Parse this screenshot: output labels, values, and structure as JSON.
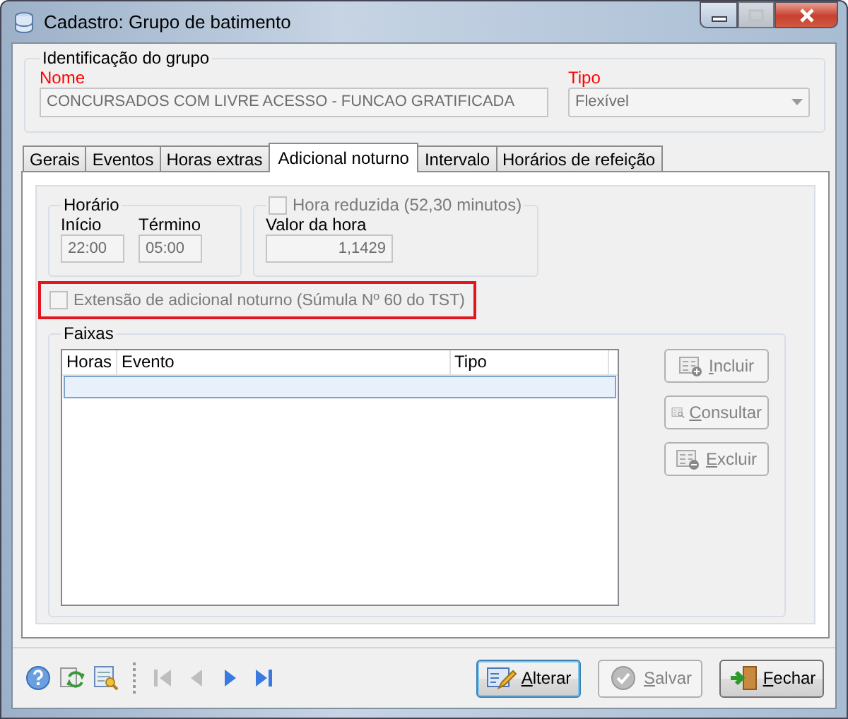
{
  "window": {
    "title": "Cadastro: Grupo de batimento",
    "controls": [
      {
        "kind": "minimize",
        "disabled": false
      },
      {
        "kind": "maximize",
        "disabled": true
      },
      {
        "kind": "close",
        "disabled": false
      }
    ]
  },
  "group": {
    "title": "Identificação do grupo",
    "fields": [
      {
        "label": "Nome",
        "value": "CONCURSADOS COM LIVRE ACESSO - FUNCAO GRATIFICADA",
        "kind": "text",
        "disabled": true
      },
      {
        "label": "Tipo",
        "value": "Flexível",
        "kind": "combo",
        "disabled": true
      }
    ]
  },
  "tabs": [
    {
      "label": "Gerais",
      "selected": false
    },
    {
      "label": "Eventos",
      "selected": false
    },
    {
      "label": "Horas extras",
      "selected": false
    },
    {
      "label": "Adicional noturno",
      "selected": true
    },
    {
      "label": "Intervalo",
      "selected": false
    },
    {
      "label": "Horários de refeição",
      "selected": false
    }
  ],
  "horario": {
    "title": "Horário",
    "fields": [
      {
        "label": "Início",
        "value": "22:00"
      },
      {
        "label": "Término",
        "value": "05:00"
      }
    ]
  },
  "hora_reduzida": {
    "label": "Hora reduzida (52,30 minutos)",
    "checked": false,
    "disabled": true,
    "field": {
      "label": "Valor da hora",
      "value": "1,1429"
    }
  },
  "extensao": {
    "label": "Extensão de adicional noturno (Súmula Nº 60 do TST)",
    "checked": false,
    "disabled": true,
    "highlighted": true
  },
  "faixas": {
    "title": "Faixas",
    "columns": [
      "Horas",
      "Evento",
      "Tipo"
    ],
    "buttons": [
      {
        "label": "Incluir",
        "kind": "add",
        "disabled": true
      },
      {
        "label": "Consultar",
        "kind": "view",
        "disabled": true
      },
      {
        "label": "Excluir",
        "kind": "remove",
        "disabled": true
      }
    ]
  },
  "toolbar": [
    {
      "kind": "help",
      "disabled": false
    },
    {
      "kind": "refresh",
      "disabled": false
    },
    {
      "kind": "search",
      "disabled": false
    },
    {
      "kind": "first",
      "disabled": true
    },
    {
      "kind": "prev",
      "disabled": true
    },
    {
      "kind": "next",
      "disabled": false
    },
    {
      "kind": "last",
      "disabled": false
    }
  ],
  "buttons": [
    {
      "label": "Alterar",
      "kind": "edit",
      "disabled": false,
      "focused": true
    },
    {
      "label": "Salvar",
      "kind": "save",
      "disabled": true,
      "focused": false
    },
    {
      "label": "Fechar",
      "kind": "close",
      "disabled": false,
      "focused": false
    }
  ]
}
